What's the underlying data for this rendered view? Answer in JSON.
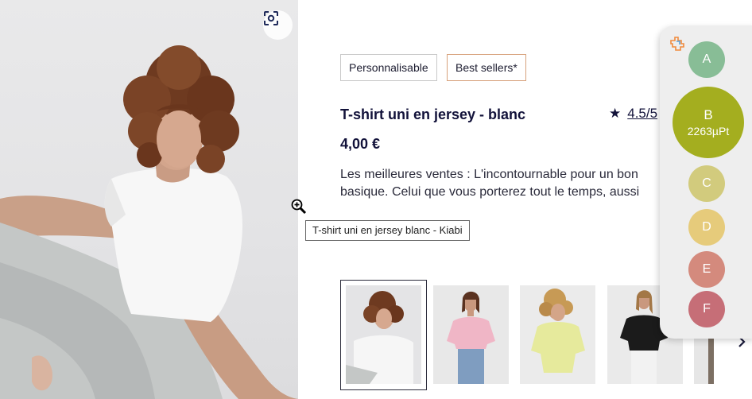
{
  "product": {
    "tags": [
      "Personnalisable",
      "Best sellers*"
    ],
    "title": "T-shirt uni en jersey - blanc",
    "rating_star": "★",
    "rating": "4.5/5",
    "price": "4,00 €",
    "description": "Les meilleures ventes : L'incontournable pour un bon basique. Celui que vous porterez tout le temps, aussi"
  },
  "tooltip": "T-shirt uni en jersey blanc - Kiabi",
  "icons": {
    "scan": "scan-icon",
    "zoom": "zoom-in-cursor-icon",
    "next": "chevron-right-icon",
    "panel_logo": "puzzle-icon"
  },
  "thumbnails": [
    {
      "alt": "white-tshirt-model",
      "selected": true
    },
    {
      "alt": "pink-tshirt-model",
      "selected": false
    },
    {
      "alt": "yellow-tshirt-model",
      "selected": false
    },
    {
      "alt": "black-tshirt-model",
      "selected": false
    }
  ],
  "score_panel": {
    "grades": [
      {
        "letter": "A",
        "color": "#88bd96"
      },
      {
        "letter": "B",
        "color": "#a4ae1f",
        "points": "2263µPt",
        "active": true
      },
      {
        "letter": "C",
        "color": "#d2cb7d"
      },
      {
        "letter": "D",
        "color": "#e6cb7b"
      },
      {
        "letter": "E",
        "color": "#d48a7d"
      },
      {
        "letter": "F",
        "color": "#c66e77"
      }
    ]
  },
  "colors": {
    "text_primary": "#12123a",
    "best_seller_border": "#d7a27c",
    "panel_bg": "#eeeeee"
  }
}
